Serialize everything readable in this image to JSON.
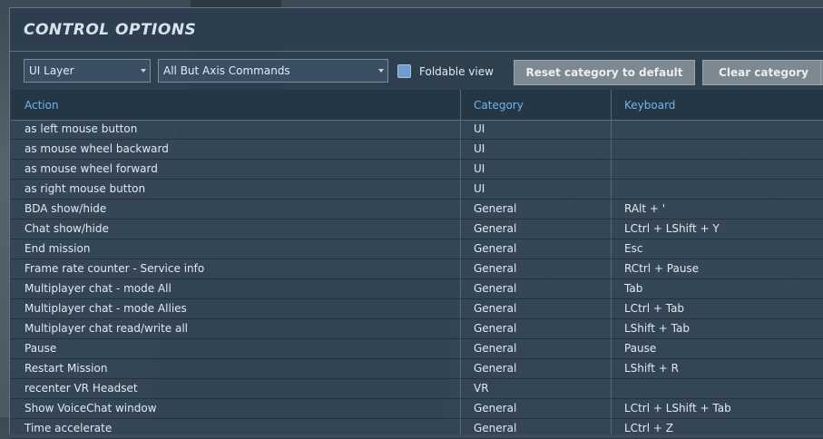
{
  "window": {
    "title": "CONTROL OPTIONS"
  },
  "toolbar": {
    "layer_select": "UI Layer",
    "filter_select": "All But Axis Commands",
    "foldable_label": "Foldable view",
    "reset_label": "Reset category to default",
    "clear_label": "Clear category"
  },
  "table": {
    "headers": {
      "action": "Action",
      "category": "Category",
      "keyboard": "Keyboard"
    },
    "rows": [
      {
        "action": "as left mouse button",
        "category": "UI",
        "keyboard": ""
      },
      {
        "action": "as mouse wheel backward",
        "category": "UI",
        "keyboard": ""
      },
      {
        "action": "as mouse wheel forward",
        "category": "UI",
        "keyboard": ""
      },
      {
        "action": "as right mouse button",
        "category": "UI",
        "keyboard": ""
      },
      {
        "action": "BDA show/hide",
        "category": "General",
        "keyboard": "RAlt + '"
      },
      {
        "action": "Chat show/hide",
        "category": "General",
        "keyboard": "LCtrl + LShift + Y"
      },
      {
        "action": "End mission",
        "category": "General",
        "keyboard": "Esc"
      },
      {
        "action": "Frame rate counter - Service info",
        "category": "General",
        "keyboard": "RCtrl + Pause"
      },
      {
        "action": "Multiplayer chat - mode All",
        "category": "General",
        "keyboard": "Tab"
      },
      {
        "action": "Multiplayer chat - mode Allies",
        "category": "General",
        "keyboard": "LCtrl + Tab"
      },
      {
        "action": "Multiplayer chat read/write all",
        "category": "General",
        "keyboard": "LShift + Tab"
      },
      {
        "action": "Pause",
        "category": "General",
        "keyboard": "Pause"
      },
      {
        "action": "Restart Mission",
        "category": "General",
        "keyboard": "LShift + R"
      },
      {
        "action": "recenter VR Headset",
        "category": "VR",
        "keyboard": ""
      },
      {
        "action": "Show VoiceChat window",
        "category": "General",
        "keyboard": "LCtrl + LShift + Tab"
      },
      {
        "action": "Time accelerate",
        "category": "General",
        "keyboard": "LCtrl + Z"
      }
    ]
  }
}
